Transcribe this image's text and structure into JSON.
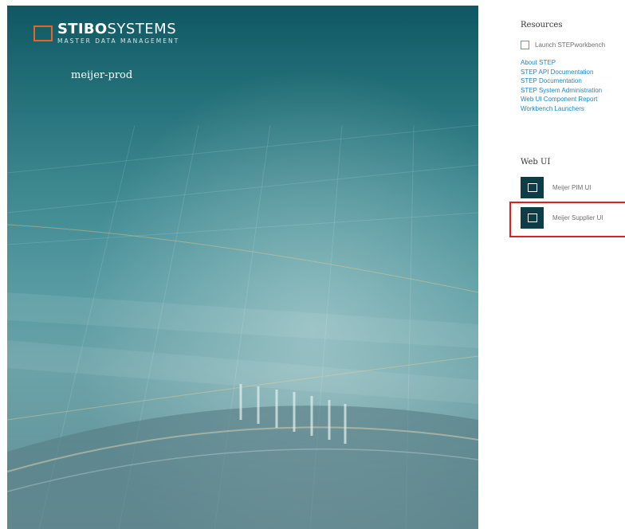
{
  "brand": {
    "logo_bold": "STIBO",
    "logo_light": "SYSTEMS",
    "logo_sub": "MASTER DATA MANAGEMENT"
  },
  "environment": {
    "name": "meijer-prod"
  },
  "resources": {
    "title": "Resources",
    "launch_label": "Launch STEPworkbench",
    "links": [
      "About STEP",
      "STEP API Documentation",
      "STEP Documentation",
      "STEP System Administration",
      "Web UI Component Report",
      "Workbench Launchers"
    ]
  },
  "web_ui": {
    "title": "Web UI",
    "apps": [
      {
        "label": "Meijer PIM UI"
      },
      {
        "label": "Meijer Supplier UI"
      }
    ]
  },
  "colors": {
    "accent_orange": "#e8622a",
    "link_blue": "#1f87c2",
    "tile_dark": "#0d3d48",
    "highlight_red": "#e02020"
  }
}
